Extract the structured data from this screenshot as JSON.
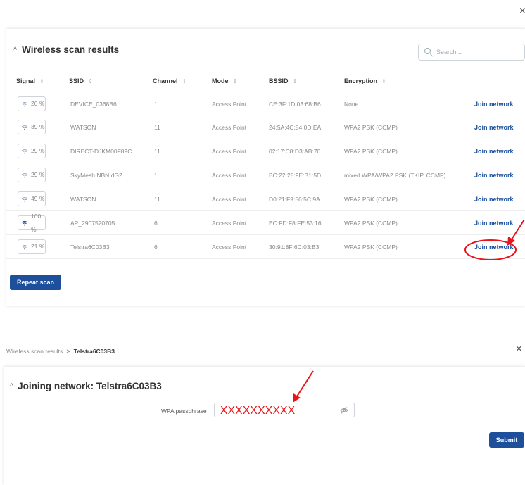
{
  "top_close": "×",
  "scan": {
    "title": "Wireless scan results",
    "search_placeholder": "Search...",
    "columns": {
      "signal": "Signal",
      "ssid": "SSID",
      "channel": "Channel",
      "mode": "Mode",
      "bssid": "BSSID",
      "encryption": "Encryption",
      "sort_icon": "sort-icon"
    },
    "rows": [
      {
        "signal": "20 %",
        "ssid": "DEVICE_0368B6",
        "channel": "1",
        "mode": "Access Point",
        "bssid": "CE:3F:1D:03:68:B6",
        "encryption": "None",
        "action": "Join network"
      },
      {
        "signal": "39 %",
        "ssid": "WATSON",
        "channel": "11",
        "mode": "Access Point",
        "bssid": "24:5A:4C:84:0D:EA",
        "encryption": "WPA2 PSK (CCMP)",
        "action": "Join network"
      },
      {
        "signal": "29 %",
        "ssid": "DIRECT-DJKM00F89C",
        "channel": "11",
        "mode": "Access Point",
        "bssid": "02:17:C8:D3:AB:70",
        "encryption": "WPA2 PSK (CCMP)",
        "action": "Join network"
      },
      {
        "signal": "29 %",
        "ssid": "SkyMesh NBN dG2",
        "channel": "1",
        "mode": "Access Point",
        "bssid": "BC:22:28:9E:B1:5D",
        "encryption": "mixed WPA/WPA2 PSK (TKIP, CCMP)",
        "action": "Join network"
      },
      {
        "signal": "49 %",
        "ssid": "WATSON",
        "channel": "11",
        "mode": "Access Point",
        "bssid": "D0:21:F9:56:5C:9A",
        "encryption": "WPA2 PSK (CCMP)",
        "action": "Join network"
      },
      {
        "signal": "100 %",
        "ssid": "AP_2907520705",
        "channel": "6",
        "mode": "Access Point",
        "bssid": "EC:FD:F8:FE:53:16",
        "encryption": "WPA2 PSK (CCMP)",
        "action": "Join network"
      },
      {
        "signal": "21 %",
        "ssid": "Telstra6C03B3",
        "channel": "6",
        "mode": "Access Point",
        "bssid": "30:91:8F:6C:03:B3",
        "encryption": "WPA2 PSK (CCMP)",
        "action": "Join network"
      }
    ],
    "repeat_label": "Repeat scan"
  },
  "breadcrumb": {
    "parent": "Wireless scan results",
    "separator": ">",
    "current": "Telstra6C03B3"
  },
  "bottom_close": "×",
  "join": {
    "title": "Joining network: Telstra6C03B3",
    "passphrase_label": "WPA passphrase",
    "passphrase_value": "XXXXXXXXXX",
    "submit_label": "Submit"
  },
  "colors": {
    "primary": "#1d4f9b",
    "link": "#1a4f9c",
    "annotation": "#e8141a"
  }
}
